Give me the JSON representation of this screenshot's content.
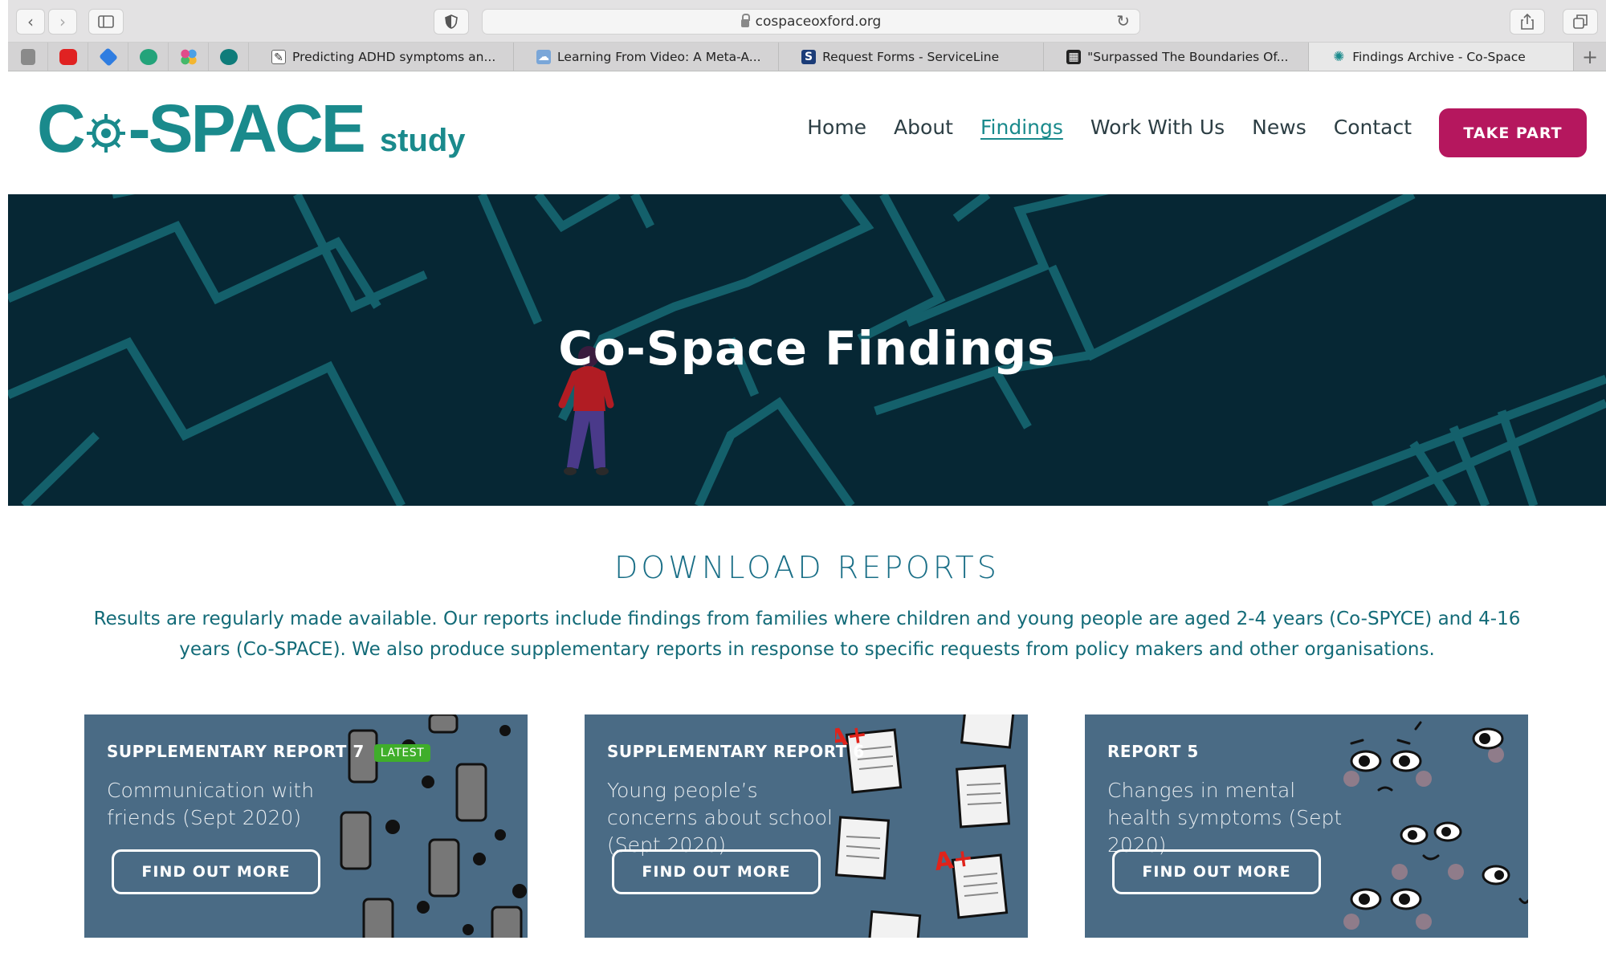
{
  "browser": {
    "url": "cospaceoxford.org",
    "tabs": [
      {
        "title": "Predicting ADHD symptoms an..."
      },
      {
        "title": "Learning From Video: A Meta-A..."
      },
      {
        "title": "Request Forms - ServiceLine"
      },
      {
        "title": "\"Surpassed The Boundaries Of..."
      },
      {
        "title": "Findings Archive - Co-Space"
      }
    ]
  },
  "site": {
    "logo": {
      "main": "Co-SPACE",
      "suffix": "study"
    },
    "nav": [
      "Home",
      "About",
      "Findings",
      "Work With Us",
      "News",
      "Contact"
    ],
    "cta": "TAKE PART"
  },
  "hero": {
    "title": "Co-Space Findings"
  },
  "downloads": {
    "title": "DOWNLOAD REPORTS",
    "text": "Results are regularly made available. Our reports include findings from families where children and young people are aged 2-4 years (Co-SPYCE) and 4-16 years (Co-SPACE). We also produce supplementary reports in response to specific requests from policy makers and other organisations."
  },
  "cards": [
    {
      "kicker": "SUPPLEMENTARY REPORT 7",
      "badge": "LATEST",
      "subtitle": "Communication with friends (Sept 2020)",
      "button": "FIND OUT MORE"
    },
    {
      "kicker": "SUPPLEMENTARY REPORT 6",
      "subtitle": "Young people’s concerns about school (Sept 2020)",
      "button": "FIND OUT MORE"
    },
    {
      "kicker": "REPORT 5",
      "subtitle": "Changes in mental health symptoms (Sept 2020)",
      "button": "FIND OUT MORE"
    }
  ]
}
